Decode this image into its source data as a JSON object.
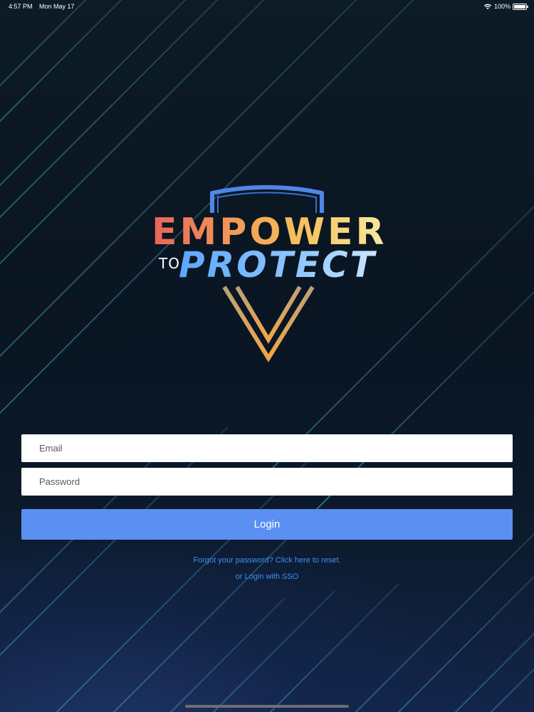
{
  "status_bar": {
    "time": "4:57 PM",
    "date": "Mon May 17",
    "battery": "100%",
    "wifi_icon": "wifi-icon",
    "battery_icon": "battery-icon"
  },
  "logo": {
    "line1": "EMPOWER",
    "line2_prefix": "TO",
    "line2": "PROTECT",
    "colors": {
      "empower_start": "#e8645a",
      "empower_end": "#f8e9a0",
      "protect": "#5aa7ff",
      "shield_top": "#4f86e6",
      "shield_bottom": "#f5a646"
    }
  },
  "form": {
    "email_placeholder": "Email",
    "email_value": "",
    "password_placeholder": "Password",
    "password_value": "",
    "login_label": "Login"
  },
  "links": {
    "forgot_password": "Forgot your password? Click here to reset.",
    "sso": "or Login with SSO"
  },
  "colors": {
    "accent": "#5b8ff2",
    "link": "#3d8ff5",
    "background": "#0a1520"
  }
}
